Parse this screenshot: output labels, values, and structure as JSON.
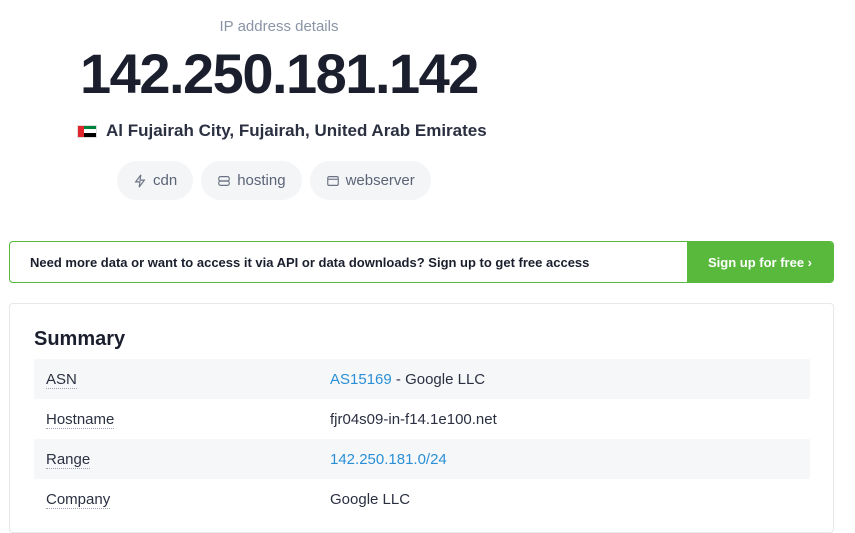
{
  "hero": {
    "subtitle": "IP address details",
    "ip": "142.250.181.142",
    "location": "Al Fujairah City, Fujairah, United Arab Emirates"
  },
  "tags": [
    {
      "label": "cdn",
      "icon": "lightning-icon"
    },
    {
      "label": "hosting",
      "icon": "server-icon"
    },
    {
      "label": "webserver",
      "icon": "browser-window-icon"
    }
  ],
  "banner": {
    "text": "Need more data or want to access it via API or data downloads? Sign up to get free access",
    "button": "Sign up for free ›"
  },
  "summary": {
    "title": "Summary",
    "rows": {
      "asn": {
        "key": "ASN",
        "link": "AS15169",
        "rest": " - Google LLC"
      },
      "hostname": {
        "key": "Hostname",
        "value": "fjr04s09-in-f14.1e100.net"
      },
      "range": {
        "key": "Range",
        "link": "142.250.181.0/24"
      },
      "company": {
        "key": "Company",
        "value": "Google LLC"
      }
    }
  },
  "colors": {
    "accent_green": "#58b93d",
    "link_blue": "#2a8fd6",
    "flag_red": "#e0262c",
    "flag_green": "#00843d",
    "flag_white": "#ffffff",
    "flag_black": "#000000"
  }
}
